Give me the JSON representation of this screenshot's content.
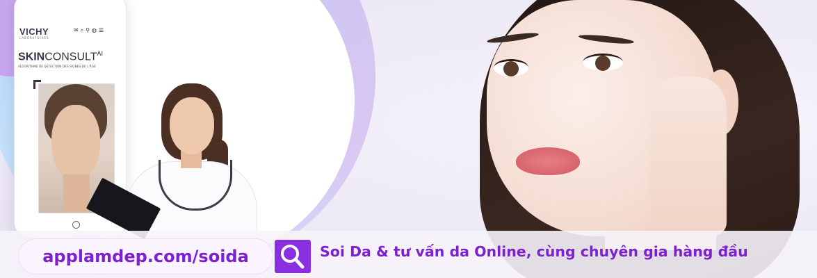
{
  "phone": {
    "brand": "VICHY",
    "brand_sub": "LABORATOIRES",
    "product_bold": "SKIN",
    "product_rest": "CONSULT",
    "product_sup": "AI",
    "product_sub": "ALGORITHME DE DÉTECTION DES SIGNES DE L'ÂGE"
  },
  "footer": {
    "url": "applamdep.com/soida",
    "tagline": "Soi Da & tư vấn da Online, cùng chuyên gia hàng đầu"
  },
  "colors": {
    "accent": "#7d21cf",
    "search_button": "#8a2fe0",
    "ring": "#b9d9f7"
  },
  "icons": [
    "search-icon",
    "mail-icon",
    "location-pin-icon",
    "globe-icon",
    "menu-icon"
  ]
}
